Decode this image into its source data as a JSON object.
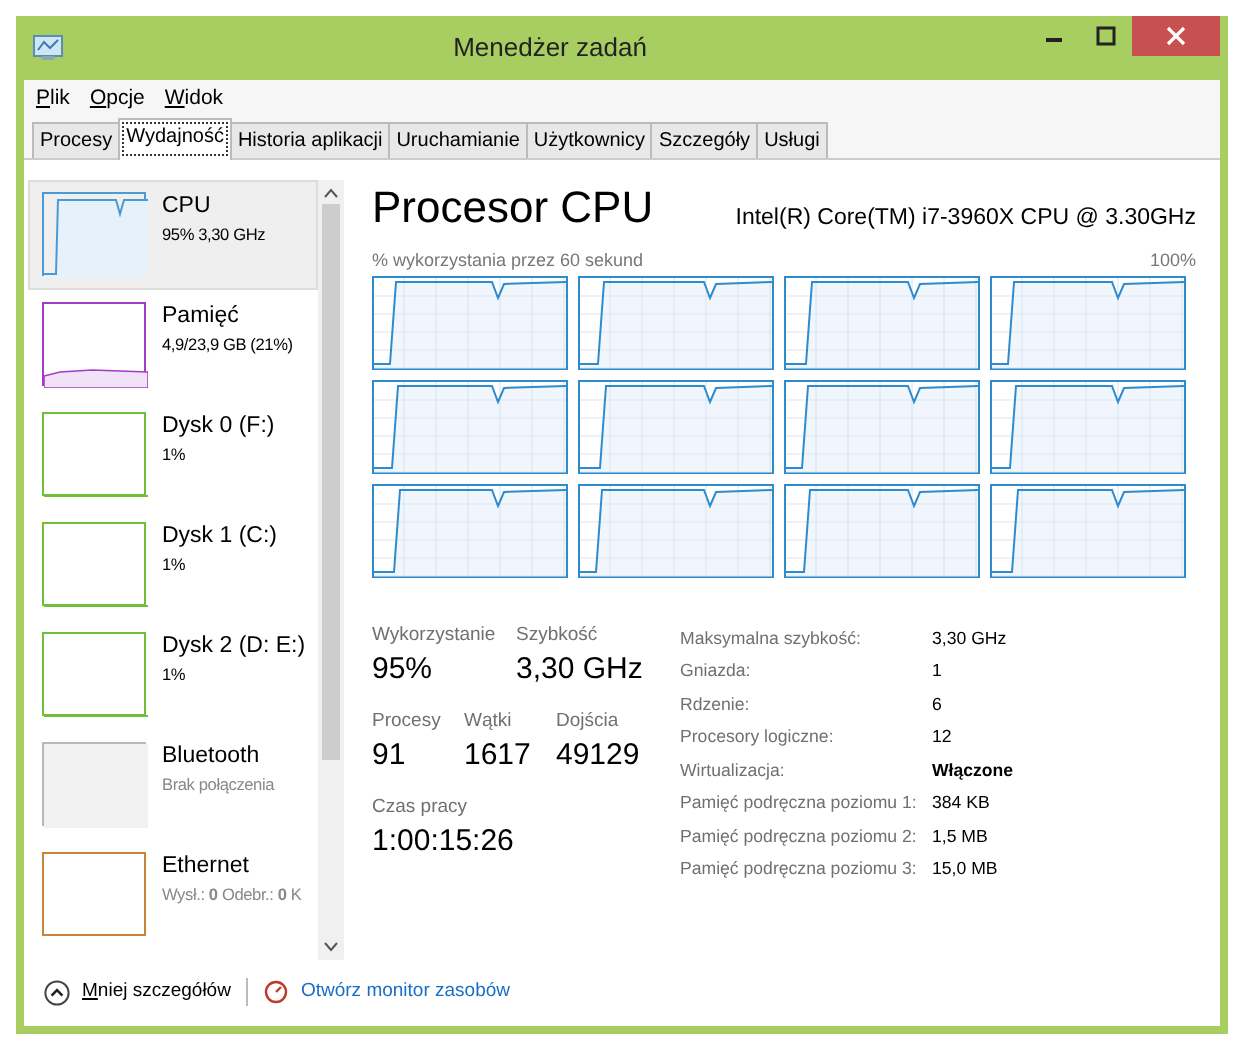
{
  "window": {
    "title": "Menedżer zadań"
  },
  "menu": [
    "Plik",
    "Opcje",
    "Widok"
  ],
  "tabs": [
    {
      "label": "Procesy",
      "selected": false
    },
    {
      "label": "Wydajność",
      "selected": true
    },
    {
      "label": "Historia aplikacji",
      "selected": false
    },
    {
      "label": "Uruchamianie",
      "selected": false
    },
    {
      "label": "Użytkownicy",
      "selected": false
    },
    {
      "label": "Szczegóły",
      "selected": false
    },
    {
      "label": "Usługi",
      "selected": false
    }
  ],
  "sidebar": {
    "items": [
      {
        "name": "CPU",
        "detail": "95% 3,30 GHz",
        "kind": "cpu",
        "color": "#4a9bd4",
        "selected": true
      },
      {
        "name": "Pamięć",
        "detail": "4,9/23,9 GB (21%)",
        "kind": "memory",
        "color": "#a43cc3",
        "selected": false
      },
      {
        "name": "Dysk 0 (F:)",
        "detail": "1%",
        "kind": "disk",
        "color": "#6fbf3a",
        "selected": false
      },
      {
        "name": "Dysk 1 (C:)",
        "detail": "1%",
        "kind": "disk",
        "color": "#6fbf3a",
        "selected": false
      },
      {
        "name": "Dysk 2 (D: E:)",
        "detail": "1%",
        "kind": "disk",
        "color": "#6fbf3a",
        "selected": false
      },
      {
        "name": "Bluetooth",
        "detail": "Brak połączenia",
        "kind": "offline",
        "color": "#b8b8b8",
        "selected": false
      },
      {
        "name": "Ethernet",
        "detail": "Wysł.: **0** Odebr.: **0** K",
        "kind": "network",
        "color": "#c6843f",
        "selected": false
      }
    ]
  },
  "main": {
    "title": "Procesor CPU",
    "model": "Intel(R) Core(TM) i7-3960X CPU @ 3.30GHz",
    "graph_caption": "% wykorzystania przez 60 sekund",
    "graph_max": "100%",
    "graphs": [
      {
        "kind": "core"
      },
      {
        "kind": "core"
      },
      {
        "kind": "core"
      },
      {
        "kind": "core"
      },
      {
        "kind": "core"
      },
      {
        "kind": "core"
      },
      {
        "kind": "core"
      },
      {
        "kind": "core"
      },
      {
        "kind": "core"
      },
      {
        "kind": "core"
      },
      {
        "kind": "core"
      },
      {
        "kind": "core"
      }
    ],
    "stat_rows": [
      [
        {
          "label": "Wykorzystanie",
          "value": "95%"
        },
        {
          "label": "Szybkość",
          "value": "3,30 GHz"
        }
      ],
      [
        {
          "label": "Procesy",
          "value": "91"
        },
        {
          "label": "Wątki",
          "value": "1617"
        },
        {
          "label": "Dojścia",
          "value": "49129"
        }
      ],
      [
        {
          "label": "Czas pracy",
          "value": "1:00:15:26"
        }
      ]
    ],
    "details": [
      {
        "label": "Maksymalna szybkość:",
        "value": "3,30 GHz",
        "bold": false
      },
      {
        "label": "Gniazda:",
        "value": "1",
        "bold": false
      },
      {
        "label": "Rdzenie:",
        "value": "6",
        "bold": false
      },
      {
        "label": "Procesory logiczne:",
        "value": "12",
        "bold": false
      },
      {
        "label": "Wirtualizacja:",
        "value": "Włączone",
        "bold": true
      },
      {
        "label": "Pamięć podręczna poziomu 1:",
        "value": "384 KB",
        "bold": false
      },
      {
        "label": "Pamięć podręczna poziomu 2:",
        "value": "1,5 MB",
        "bold": false
      },
      {
        "label": "Pamięć podręczna poziomu 3:",
        "value": "15,0 MB",
        "bold": false
      }
    ]
  },
  "footer": {
    "less_details": "Mniej szczegółów",
    "resource_monitor": "Otwórz monitor zasobów"
  }
}
